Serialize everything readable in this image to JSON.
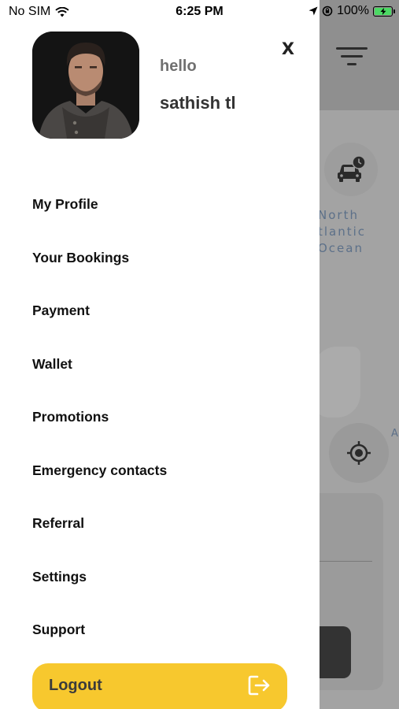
{
  "status_bar": {
    "carrier": "No SIM",
    "time": "6:25 PM",
    "battery_percent": "100%",
    "icons": [
      "wifi-icon",
      "location-arrow-icon",
      "orientation-lock-icon",
      "battery-charging-icon"
    ]
  },
  "drawer": {
    "greeting": "hello",
    "user_name": "sathish tl",
    "close_label": "X",
    "menu": [
      {
        "label": "My Profile"
      },
      {
        "label": "Your Bookings"
      },
      {
        "label": "Payment"
      },
      {
        "label": "Wallet"
      },
      {
        "label": "Promotions"
      },
      {
        "label": "Emergency contacts"
      },
      {
        "label": "Referral"
      },
      {
        "label": "Settings"
      },
      {
        "label": "Support"
      }
    ],
    "logout_label": "Logout",
    "logout_icon": "logout-icon"
  },
  "map": {
    "ocean_label": "North Atlantic Ocean",
    "ocean_label_visible": "North\ntlantic\nOcean",
    "edge_label": "A",
    "icons": [
      "filter-icon",
      "car-clock-icon",
      "crosshair-icon"
    ]
  },
  "colors": {
    "accent": "#f7c82e",
    "overlay": "#8f8f8f",
    "drawer_bg": "#ffffff",
    "battery": "#4cd964"
  }
}
